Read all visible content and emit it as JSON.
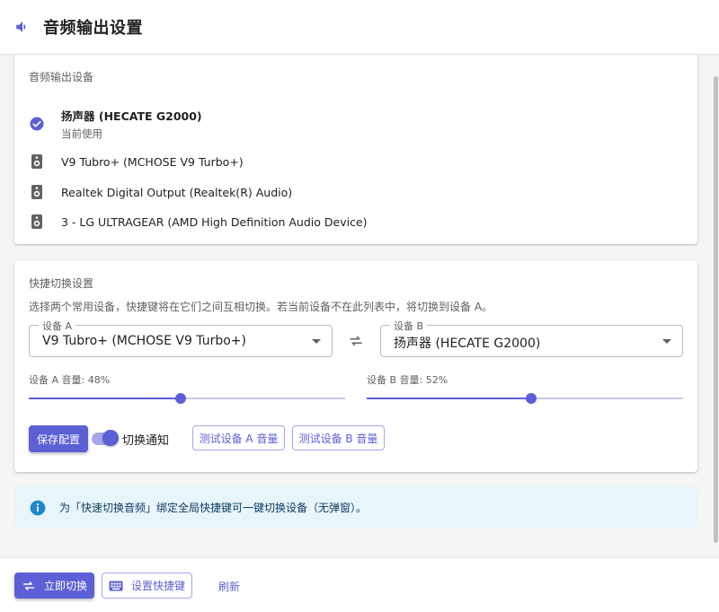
{
  "header": {
    "title": "音频输出设置",
    "icon": "volume-icon"
  },
  "output_devices": {
    "label": "音频输出设备",
    "items": [
      {
        "name": "扬声器 (HECATE G2000)",
        "sub": "当前使用",
        "icon": "check-circle-icon",
        "current": true
      },
      {
        "name": "V9 Tubro+ (MCHOSE V9 Turbo+)",
        "icon": "speaker-icon"
      },
      {
        "name": "Realtek Digital Output (Realtek(R) Audio)",
        "icon": "speaker-icon"
      },
      {
        "name": "3 - LG ULTRAGEAR (AMD High Definition Audio Device)",
        "icon": "speaker-icon"
      }
    ]
  },
  "quick_switch": {
    "label": "快捷切换设置",
    "description": "选择两个常用设备，快捷键将在它们之间互相切换。若当前设备不在此列表中，将切换到设备 A。",
    "device_a": {
      "legend": "设备 A",
      "value": "V9 Tubro+ (MCHOSE V9 Turbo+)"
    },
    "device_b": {
      "legend": "设备 B",
      "value": "扬声器 (HECATE G2000)"
    },
    "volume_a": {
      "label": "设备 A 音量: 48%",
      "value": 48
    },
    "volume_b": {
      "label": "设备 B 音量: 52%",
      "value": 52
    },
    "save_label": "保存配置",
    "notify_label": "切换通知",
    "notify_on": true,
    "test_a_label": "测试设备 A 音量",
    "test_b_label": "测试设备 B 音量"
  },
  "info": {
    "text": "为「快速切换音频」绑定全局快捷键可一键切换设备（无弹窗）。"
  },
  "footer": {
    "switch_now_label": "立即切换",
    "set_hotkey_label": "设置快捷键",
    "refresh_label": "刷新"
  },
  "colors": {
    "accent": "#5c5fd6",
    "info_bg": "#e8f5fb",
    "info_icon": "#1e88c9"
  }
}
